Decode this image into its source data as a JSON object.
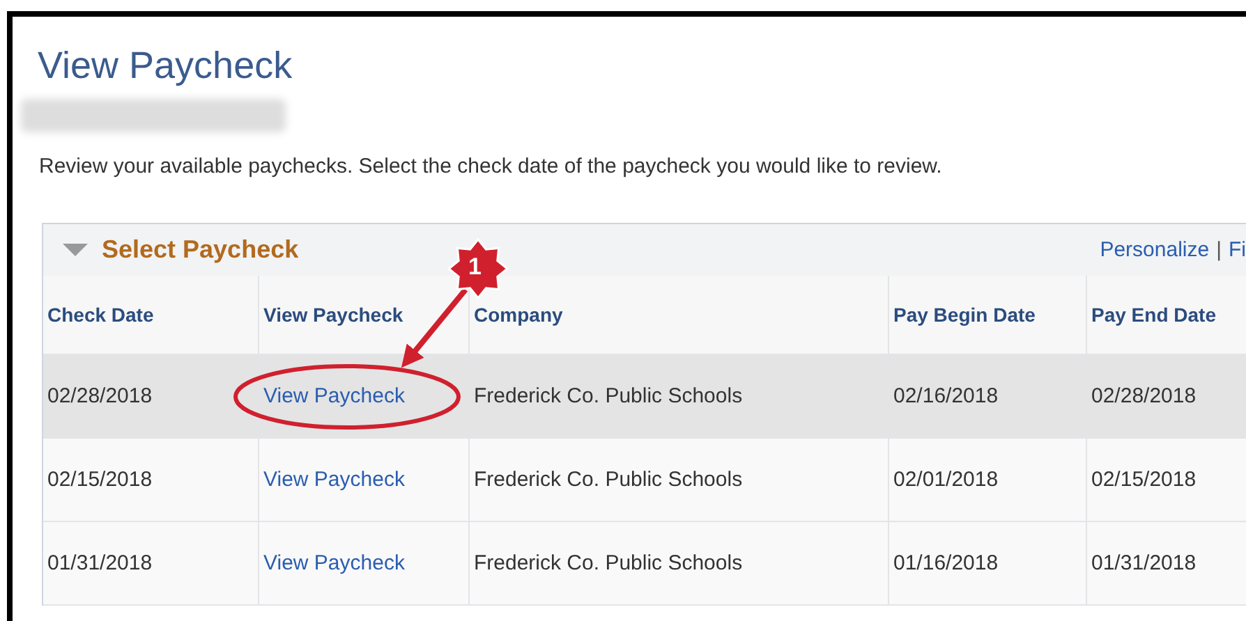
{
  "page": {
    "title": "View Paycheck",
    "user_name": {
      "kind": "blurred"
    },
    "instructions": "Review your available paychecks. Select the check date of the paycheck you would like to review."
  },
  "grid": {
    "title": "Select Paycheck",
    "expanded": true,
    "toolbar": [
      {
        "kind": "link",
        "text": "Personalize"
      },
      {
        "kind": "separator",
        "text": "|"
      },
      {
        "kind": "link",
        "text": "Fi"
      }
    ],
    "columns": [
      "Check Date",
      "View Paycheck",
      "Company",
      "Pay Begin Date",
      "Pay End Date"
    ],
    "rows": [
      {
        "selected": true,
        "cells": [
          "02/28/2018",
          "View Paycheck",
          "Frederick Co. Public Schools",
          "02/16/2018",
          "02/28/2018"
        ]
      },
      {
        "selected": false,
        "cells": [
          "02/15/2018",
          "View Paycheck",
          "Frederick Co. Public Schools",
          "02/01/2018",
          "02/15/2018"
        ]
      },
      {
        "selected": false,
        "cells": [
          "01/31/2018",
          "View Paycheck",
          "Frederick Co. Public Schools",
          "01/16/2018",
          "01/31/2018"
        ]
      }
    ]
  },
  "annotation": {
    "badge": "1"
  }
}
